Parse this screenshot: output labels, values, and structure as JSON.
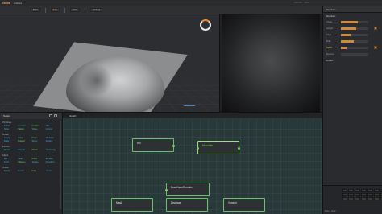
{
  "app": {
    "logo": "Gaea",
    "menu": [
      "Untitled"
    ],
    "top_right": "EXPORT  ·  SAVE"
  },
  "toolbar": {
    "buttons": [
      "Build",
      "Bake",
      "Tools",
      "Settings"
    ]
  },
  "viewport": {
    "accent": "#ef8a2b"
  },
  "properties": {
    "title": "Mountain",
    "section": "Mountain",
    "rows": [
      {
        "label": "Scale",
        "value": 0.62,
        "highlight": false
      },
      {
        "label": "Height",
        "value": 0.55,
        "highlight": false
      },
      {
        "label": "Style",
        "value": 0.35,
        "highlight": false
      },
      {
        "label": "Bulk",
        "value": 0.48,
        "highlight": false
      },
      {
        "label": "Seed",
        "value": 0.2,
        "highlight": true
      },
      {
        "label": "Reduce",
        "value": 0.0,
        "highlight": false
      }
    ],
    "section2": "Output",
    "status": "Bake · Node"
  },
  "library": {
    "title": "Nodes",
    "groups": [
      {
        "name": "Primitives",
        "items": [
          "Cellular",
          "Constant",
          "Gradient",
          "Hills",
          "Noise",
          "Pattern",
          "Shape",
          "Voronoi"
        ]
      },
      {
        "name": "Terrain",
        "items": [
          "Canyon",
          "Crater",
          "Dunes",
          "Mountain",
          "Ridge",
          "Rugged",
          "Slump",
          "Volcano"
        ]
      },
      {
        "name": "Erosion",
        "items": [
          "Erosion",
          "Thermal",
          "Wizard",
          "Weathering"
        ]
      },
      {
        "name": "Adjust",
        "items": [
          "Blur",
          "Clamp",
          "Curve",
          "Equalize",
          "Invert",
          "Sharpen",
          "Terrace",
          "Transform"
        ]
      },
      {
        "name": "Output",
        "items": [
          "Export",
          "Mesher",
          "Unity",
          "Unreal"
        ]
      }
    ]
  },
  "graph": {
    "tab": "Graph",
    "nodes": {
      "hill": "Hill",
      "mountain": "Mountain",
      "drawnode": "DrawNodeRemake",
      "mask": "Mask",
      "displace": "Displace",
      "voronoi": "Voronoi"
    }
  }
}
